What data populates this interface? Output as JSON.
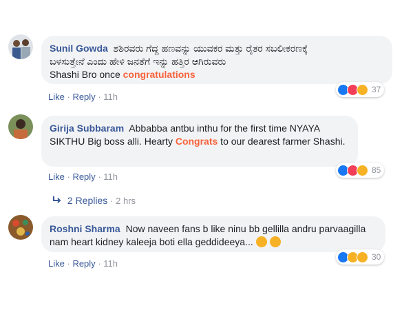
{
  "comments": [
    {
      "author": "Sunil Gowda",
      "text_line1": "ಶಶಿರವರು ಗೆದ್ದ ಹಣವನ್ನು ಯುವಕರ ಮತ್ತು ರೈತರ ಸಬಲೀಕರಣಕ್ಕೆ",
      "text_line2": "ಬಳಸುತ್ತೇನೆ ಎಂದು ಹೇಳಿ ಜನತೆಗೆ ಇನ್ನು ಹತ್ತಿರ ಆಗಿರುವರು",
      "text_line3": "Shashi Bro once ",
      "highlight": "congratulations",
      "like": "Like",
      "reply": "Reply",
      "time": "11h",
      "reaction_count": "37"
    },
    {
      "author": "Girija Subbaram",
      "text_before": "Abbabba antbu inthu for the first time NYAYA SIKTHU Big boss alli. Hearty ",
      "highlight": "Congrats",
      "text_after": " to our dearest farmer Shashi.",
      "like": "Like",
      "reply": "Reply",
      "time": "11h",
      "reaction_count": "85"
    },
    {
      "author": "Roshni Sharma",
      "text": "Now naveen fans b like ninu bb gellilla andru parvaagilla nam heart kidney kaleeja boti ella geddideeya...",
      "like": "Like",
      "reply": "Reply",
      "time": "11h",
      "reaction_count": "30"
    }
  ],
  "replies_link": {
    "label": "2 Replies",
    "time": "2 hrs"
  },
  "colors": {
    "link_blue": "#385898",
    "highlight_orange": "#f7633b",
    "bubble_gray": "#f2f3f5",
    "meta_gray": "#90949c"
  }
}
